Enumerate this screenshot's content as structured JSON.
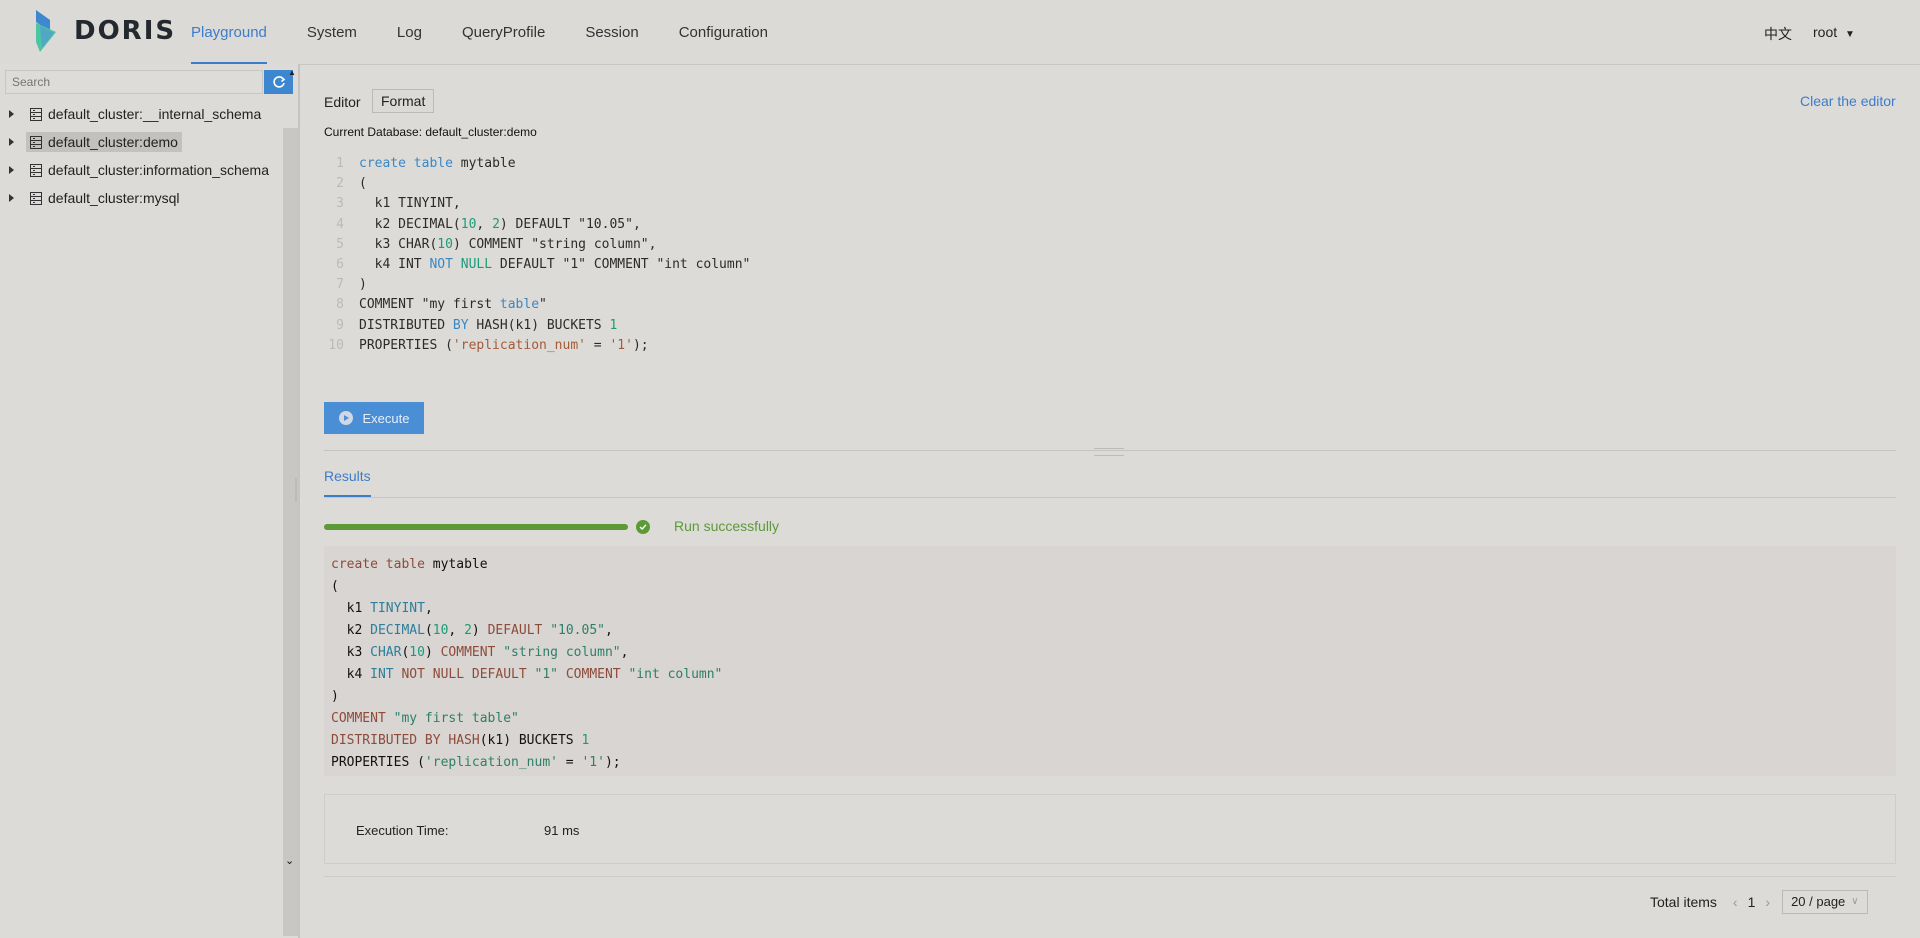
{
  "app": {
    "logo_text": "DORIS"
  },
  "nav": [
    "Playground",
    "System",
    "Log",
    "QueryProfile",
    "Session",
    "Configuration"
  ],
  "header": {
    "language": "中文",
    "user": "root"
  },
  "sidebar": {
    "search_placeholder": "Search",
    "databases": [
      "default_cluster:__internal_schema",
      "default_cluster:demo",
      "default_cluster:information_schema",
      "default_cluster:mysql"
    ]
  },
  "editor": {
    "label": "Editor",
    "format_button": "Format",
    "clear_link": "Clear the editor",
    "current_database": "Current Database: default_cluster:demo",
    "line_numbers": [
      "1",
      "2",
      "3",
      "4",
      "5",
      "6",
      "7",
      "8",
      "9",
      "10"
    ],
    "execute_button": "Execute"
  },
  "results": {
    "tab_label": "Results",
    "progress_percent": 100,
    "status_text": "Run successfully",
    "execution_time_label": "Execution Time:",
    "execution_time_value": "91 ms"
  },
  "pagination": {
    "total_label": "Total items",
    "current_page": "1",
    "page_size": "20 / page"
  },
  "colors": {
    "accent": "#3d7cc9",
    "success": "#5c9a37",
    "execute_button": "#4a8ed6"
  }
}
